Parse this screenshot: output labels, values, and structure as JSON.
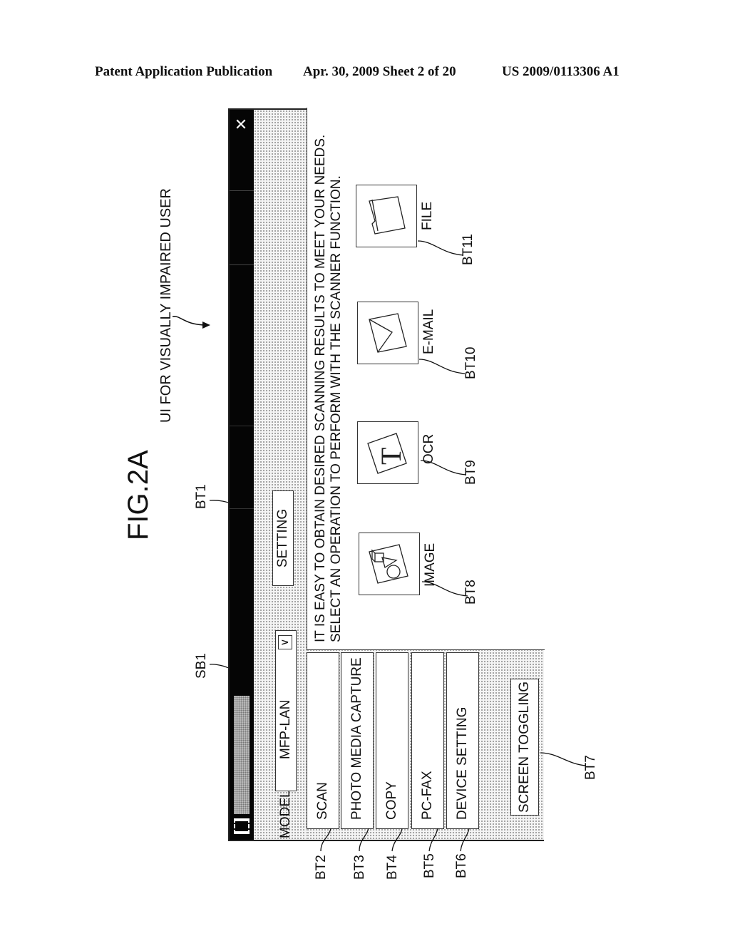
{
  "header": {
    "publication": "Patent Application Publication",
    "date_sheet": "Apr. 30, 2009  Sheet 2 of 20",
    "pub_number": "US 2009/0113306 A1"
  },
  "figure": {
    "title": "FIG.2A",
    "caption": "UI FOR VISUALLY IMPAIRED USER"
  },
  "window": {
    "close_glyph": "✕",
    "model_label": "MODEL",
    "model_select": {
      "value": "MFP-LAN",
      "chevron": "∨"
    },
    "setting_button": "SETTING",
    "nav_items": [
      {
        "label": "SCAN",
        "ref": "BT2"
      },
      {
        "label": "PHOTO MEDIA CAPTURE",
        "ref": "BT3"
      },
      {
        "label": "COPY",
        "ref": "BT4"
      },
      {
        "label": "PC-FAX",
        "ref": "BT5"
      },
      {
        "label": "DEVICE SETTING",
        "ref": "BT6"
      }
    ],
    "screen_toggling_button": "SCREEN TOGGLING",
    "instructions": [
      "IT IS EASY TO OBTAIN DESIRED SCANNING RESULTS TO MEET YOUR NEEDS.",
      "SELECT AN OPERATION TO PERFORM WITH THE SCANNER FUNCTION."
    ],
    "scan_options": [
      {
        "label": "IMAGE",
        "icon": "image-icon",
        "ref": "BT8"
      },
      {
        "label": "OCR",
        "icon": "ocr-icon",
        "ref": "BT9"
      },
      {
        "label": "E-MAIL",
        "icon": "email-icon",
        "ref": "BT10"
      },
      {
        "label": "FILE",
        "icon": "folder-icon",
        "ref": "BT11"
      }
    ]
  },
  "refs": {
    "setting": "BT1",
    "model_select": "SB1",
    "screen_toggling": "BT7"
  }
}
